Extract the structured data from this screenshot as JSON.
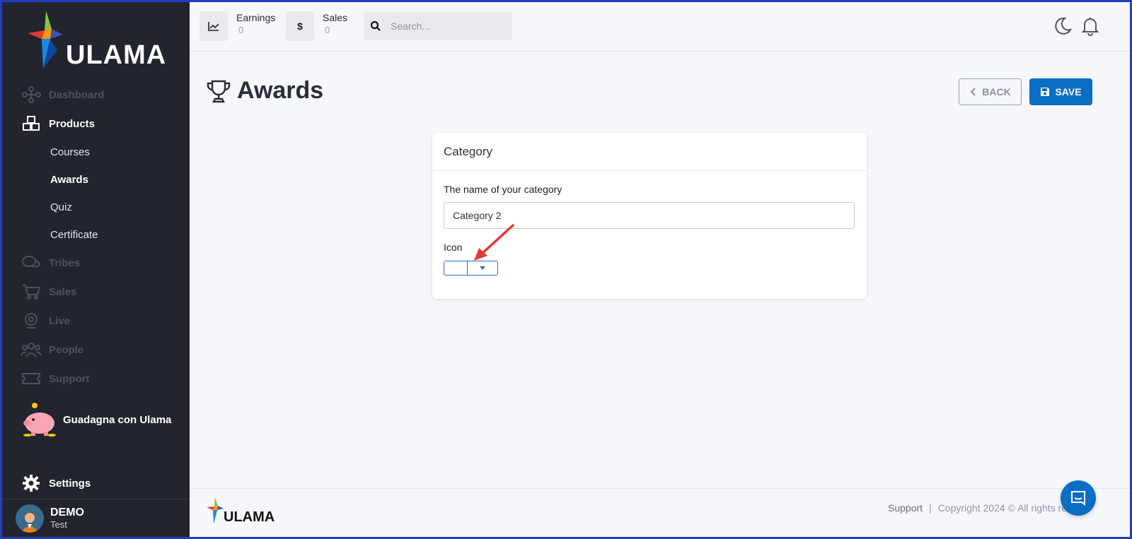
{
  "sidebar": {
    "brand": "ULAMA",
    "nav": [
      {
        "label": "Dashboard",
        "icon": "dashboard-network-icon",
        "active": false
      },
      {
        "label": "Products",
        "icon": "cubes-icon",
        "active": true
      },
      {
        "label": "Tribes",
        "icon": "chat-bubbles-icon",
        "active": false
      },
      {
        "label": "Sales",
        "icon": "cart-icon",
        "active": false
      },
      {
        "label": "Live",
        "icon": "webcam-icon",
        "active": false
      },
      {
        "label": "People",
        "icon": "people-icon",
        "active": false
      },
      {
        "label": "Support",
        "icon": "ticket-icon",
        "active": false
      }
    ],
    "products_sub": [
      {
        "label": "Courses",
        "active": false
      },
      {
        "label": "Awards",
        "active": true
      },
      {
        "label": "Quiz",
        "active": false
      },
      {
        "label": "Certificate",
        "active": false
      }
    ],
    "promo_label": "Guadagna con Ulama",
    "settings_label": "Settings",
    "user": {
      "name": "DEMO",
      "role": "Test"
    }
  },
  "topbar": {
    "earnings": {
      "label": "Earnings",
      "value": "0"
    },
    "sales": {
      "label": "Sales",
      "value": "0",
      "icon_text": "$"
    },
    "search_placeholder": "Search..."
  },
  "page": {
    "title": "Awards",
    "back_label": "BACK",
    "save_label": "SAVE"
  },
  "card": {
    "header": "Category",
    "name_label": "The name of your category",
    "name_value": "Category 2",
    "icon_label": "Icon"
  },
  "footer": {
    "brand": "ULAMA",
    "support_label": "Support",
    "separator": "|",
    "copyright": "Copyright 2024 © All rights res"
  },
  "colors": {
    "sidebar_bg": "#22252e",
    "primary": "#0b6ec5",
    "annotation_arrow": "#e53935"
  }
}
